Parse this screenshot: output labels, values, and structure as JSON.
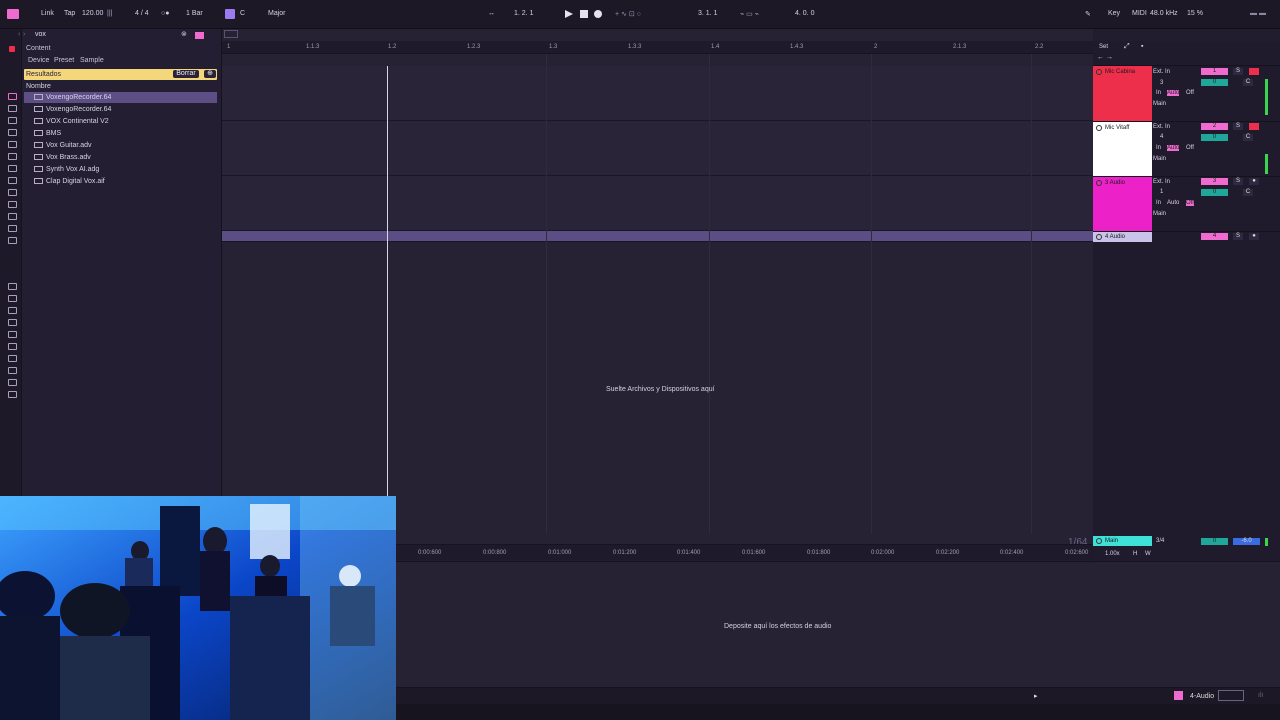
{
  "toolbar": {
    "link": "Link",
    "tap": "Tap",
    "tempo": "120.00",
    "time_signature": "4 / 4",
    "quantize": "1 Bar",
    "key_root": "C",
    "scale": "Major",
    "position": "1.   2.   1",
    "loop_start": "3.   1.   1",
    "loop_length": "4.   0.   0",
    "key_label": "Key",
    "midi_label": "MIDI",
    "sample_rate": "48.0 kHz",
    "cpu": "15 %"
  },
  "browser": {
    "search_value": "vox",
    "content_label": "Content",
    "filter_device": "Device",
    "filter_preset": "Preset",
    "filter_sample": "Sample",
    "results_label": "Resultados",
    "clear_button": "Borrar",
    "column_name": "Nombre",
    "items": [
      "VoxengoRecorder.64",
      "VoxengoRecorder.64",
      "VOX Continental V2",
      "BMS",
      "Vox Guitar.adv",
      "Vox Brass.adv",
      "Synth Vox AI.adg",
      "Clap Digital Vox.aif"
    ]
  },
  "ruler": {
    "marks": [
      "1",
      "1.1.3",
      "1.2",
      "1.2.3",
      "1.3",
      "1.3.3",
      "1.4",
      "1.4.3",
      "2",
      "2.1.3",
      "2.2"
    ]
  },
  "arrangement": {
    "drop_hint": "Suelte Archivos y Dispositivos aquí",
    "set_button": "Set",
    "zoom_readout": "1/64"
  },
  "tracks": [
    {
      "name": "Mic Cabina",
      "color": "#ee2f4b",
      "input": "Ext. In",
      "channel": "3",
      "monitor_in": "In",
      "monitor_auto": "Auto",
      "monitor_off": "Off",
      "output": "Main",
      "number": "1",
      "volume": "0",
      "pan": "C"
    },
    {
      "name": "Mic Vitaff",
      "color": "#ffffff",
      "input": "Ext. In",
      "channel": "4",
      "monitor_in": "In",
      "monitor_auto": "Auto",
      "monitor_off": "Off",
      "output": "Main",
      "number": "2",
      "volume": "0",
      "pan": "C"
    },
    {
      "name": "3 Audio",
      "color": "#ec22c8",
      "input": "Ext. In",
      "channel": "1",
      "monitor_in": "In",
      "monitor_auto": "Auto",
      "monitor_off": "Off",
      "output": "Main",
      "number": "3",
      "volume": "0",
      "pan": "C"
    },
    {
      "name": "4 Audio",
      "color": "#c9c3ea",
      "number": "4"
    }
  ],
  "main_track": {
    "name": "Main",
    "time_sig": "3/4",
    "volume": "0",
    "level": "-6.0",
    "speed": "1.00x",
    "h": "H",
    "w": "W"
  },
  "timeline": {
    "labels": [
      "0:00:600",
      "0:00:800",
      "0:01:000",
      "0:01:200",
      "0:01:400",
      "0:01:600",
      "0:01:800",
      "0:02:000",
      "0:02:200",
      "0:02:400",
      "0:02:600"
    ]
  },
  "device_panel": {
    "hint": "Deposite aquí los efectos de audio"
  },
  "status": {
    "selected_track": "4-Audio"
  },
  "colors": {
    "accent_pink": "#f06bd0",
    "accent_purple": "#9b7bf0",
    "results_yellow": "#f4d77a"
  }
}
